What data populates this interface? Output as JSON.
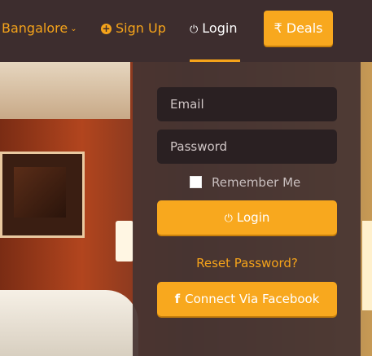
{
  "nav": {
    "city": "Bangalore",
    "signup": "Sign Up",
    "login": "Login",
    "deals": "Deals",
    "deals_icon": "₹"
  },
  "form": {
    "email_placeholder": "Email",
    "password_placeholder": "Password",
    "remember_label": "Remember Me",
    "remember_checked": false,
    "login_button": "Login",
    "reset_link": "Reset Password?",
    "facebook_button": "Connect Via Facebook"
  },
  "colors": {
    "accent": "#f8a81e",
    "nav_bg": "#3d2d2e",
    "panel_bg": "#463432",
    "field_bg": "#2a2022"
  }
}
